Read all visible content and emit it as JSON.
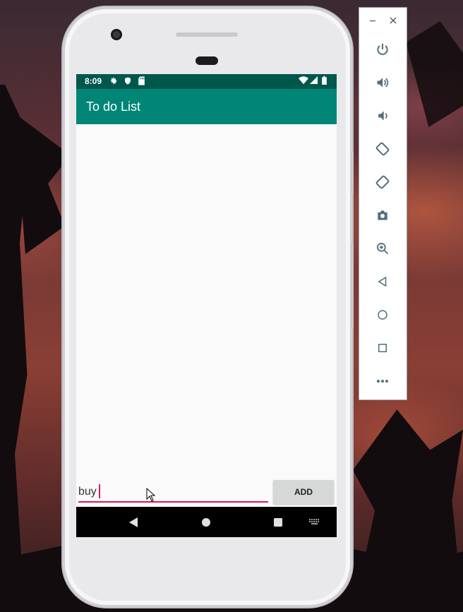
{
  "status_bar": {
    "time": "8:09"
  },
  "app_bar": {
    "title": "To do List"
  },
  "todo_input": {
    "value": "buy"
  },
  "add_button": {
    "label": "ADD"
  },
  "emulator_panel": {
    "window_controls": [
      "minimize-icon",
      "close-icon"
    ],
    "tools": [
      "power-icon",
      "volume-up-icon",
      "volume-down-icon",
      "rotate-left-icon",
      "rotate-right-icon",
      "camera-icon",
      "zoom-icon",
      "back-icon",
      "home-icon",
      "overview-icon",
      "more-icon"
    ]
  },
  "colors": {
    "status_bar": "#00574b",
    "app_bar": "#008577",
    "accent": "#d81b60",
    "button": "#d6d7d7"
  }
}
